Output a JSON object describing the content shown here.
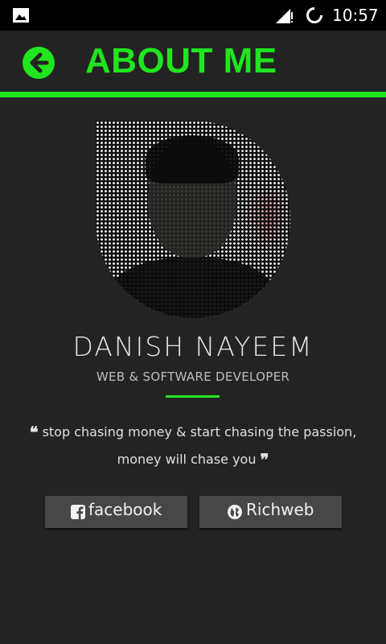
{
  "status_bar": {
    "time": "10:57",
    "icons": [
      "image-icon",
      "signal-icon",
      "loading-icon"
    ]
  },
  "app_bar": {
    "title": "ABOUT ME",
    "back_icon": "arrow-left-circle-icon",
    "accent_color": "#21e51f"
  },
  "profile": {
    "name": "DANISH NAYEEM",
    "role": "WEB & SOFTWARE DEVELOPER"
  },
  "quote": {
    "line1": "stop chasing money & start chasing the passion,",
    "line2": "money will chase you"
  },
  "links": [
    {
      "label": "facebook",
      "icon": "facebook-icon"
    },
    {
      "label": "Richweb",
      "icon": "globe-icon"
    }
  ],
  "colors": {
    "background": "#232323",
    "accent": "#21e51f",
    "button": "#474747"
  }
}
